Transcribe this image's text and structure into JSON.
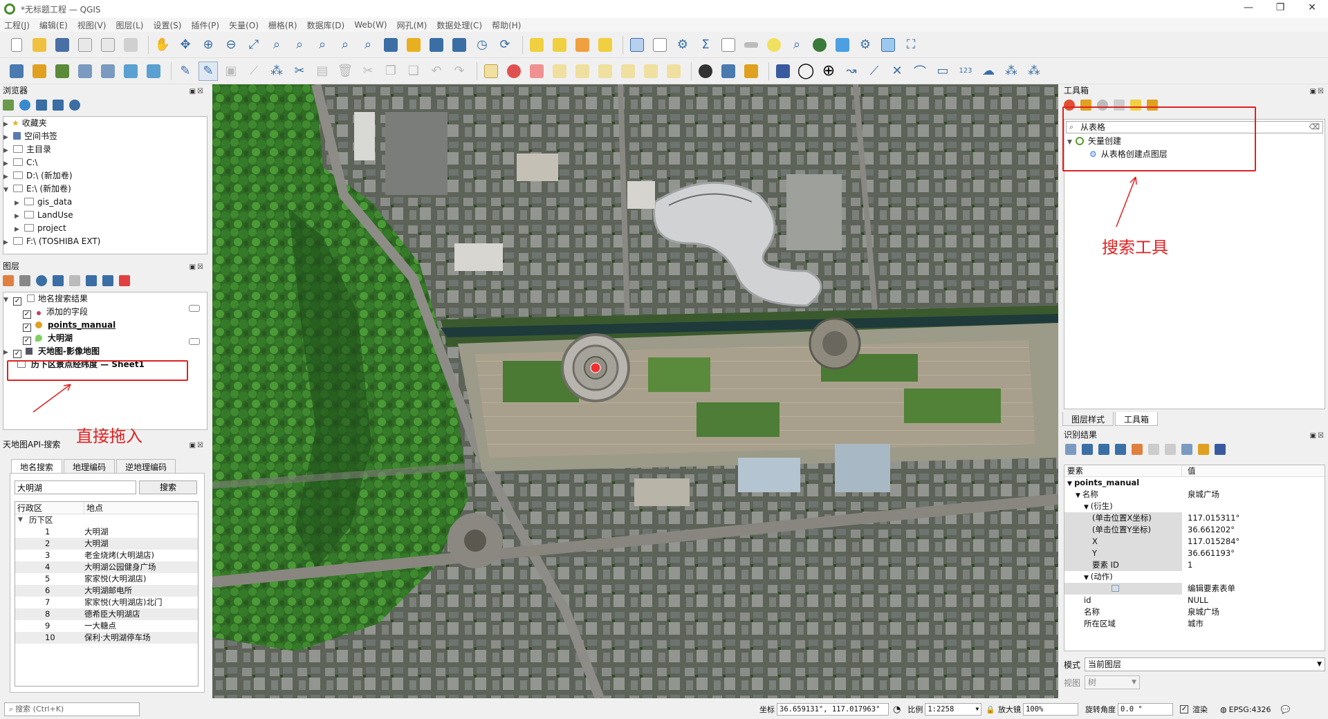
{
  "window": {
    "title": "*无标题工程 — QGIS"
  },
  "menu": [
    "工程(J)",
    "编辑(E)",
    "视图(V)",
    "图层(L)",
    "设置(S)",
    "插件(P)",
    "矢量(O)",
    "栅格(R)",
    "数据库(D)",
    "Web(W)",
    "网孔(M)",
    "数据处理(C)",
    "帮助(H)"
  ],
  "browser": {
    "title": "浏览器",
    "items": [
      {
        "label": "收藏夹",
        "indent": 0
      },
      {
        "label": "空间书签",
        "indent": 0
      },
      {
        "label": "主目录",
        "indent": 0
      },
      {
        "label": "C:\\",
        "indent": 0
      },
      {
        "label": "D:\\ (新加卷)",
        "indent": 0
      },
      {
        "label": "E:\\ (新加卷)",
        "indent": 0
      },
      {
        "label": "gis_data",
        "indent": 1
      },
      {
        "label": "LandUse",
        "indent": 1
      },
      {
        "label": "project",
        "indent": 1
      },
      {
        "label": "F:\\ (TOSHIBA EXT)",
        "indent": 0
      }
    ]
  },
  "layers": {
    "title": "图层",
    "items": [
      {
        "label": "地名搜索结果",
        "type": "group"
      },
      {
        "label": "添加的字段",
        "type": "layer"
      },
      {
        "label": "points_manual",
        "type": "layer"
      },
      {
        "label": "大明湖",
        "type": "layer"
      },
      {
        "label": "天地图-影像地图",
        "type": "raster"
      },
      {
        "label": "历下区景点经纬度 — Sheet1",
        "type": "table"
      }
    ]
  },
  "tianditu": {
    "title": "天地图API-搜索",
    "tabs": [
      "地名搜索",
      "地理编码",
      "逆地理编码"
    ],
    "search_value": "大明湖",
    "search_button": "搜索",
    "columns": [
      "行政区",
      "地点"
    ],
    "district": "历下区",
    "results": [
      {
        "n": "1",
        "place": "大明湖"
      },
      {
        "n": "2",
        "place": "大明湖"
      },
      {
        "n": "3",
        "place": "老金烧烤(大明湖店)"
      },
      {
        "n": "4",
        "place": "大明湖公园健身广场"
      },
      {
        "n": "5",
        "place": "家家悦(大明湖店)"
      },
      {
        "n": "6",
        "place": "大明湖邮电所"
      },
      {
        "n": "7",
        "place": "家家悦(大明湖店)北门"
      },
      {
        "n": "8",
        "place": "德希臣大明湖店"
      },
      {
        "n": "9",
        "place": "一大糖点"
      },
      {
        "n": "10",
        "place": "保利·大明湖停车场"
      }
    ]
  },
  "toolbox": {
    "title": "工具箱",
    "search_value": "从表格",
    "group": "矢量创建",
    "tool": "从表格创建点图层",
    "tabs": [
      "图层样式",
      "工具箱"
    ]
  },
  "identify": {
    "title": "识别结果",
    "columns": [
      "要素",
      "值"
    ],
    "rows": [
      {
        "k": "points_manual",
        "v": "",
        "indent": 0,
        "bold": true
      },
      {
        "k": "名称",
        "v": "泉城广场",
        "indent": 1
      },
      {
        "k": "(衍生)",
        "v": "",
        "indent": 2
      },
      {
        "k": "(单击位置X坐标)",
        "v": "117.015311°",
        "indent": 3,
        "hl": true
      },
      {
        "k": "(单击位置Y坐标)",
        "v": "36.661202°",
        "indent": 3,
        "hl": true
      },
      {
        "k": "X",
        "v": "117.015284°",
        "indent": 3,
        "hl": true
      },
      {
        "k": "Y",
        "v": "36.661193°",
        "indent": 3,
        "hl": true
      },
      {
        "k": "要素 ID",
        "v": "1",
        "indent": 3,
        "hl": true
      },
      {
        "k": "(动作)",
        "v": "",
        "indent": 2
      },
      {
        "k": "",
        "v": "编辑要素表单",
        "indent": 3,
        "hl": true
      },
      {
        "k": "id",
        "v": "NULL",
        "indent": 2
      },
      {
        "k": "名称",
        "v": "泉城广场",
        "indent": 2
      },
      {
        "k": "所在区域",
        "v": "城市",
        "indent": 2
      }
    ],
    "mode_label": "模式",
    "mode_value": "当前图层",
    "view_label": "视图",
    "view_value": "树"
  },
  "status": {
    "search_placeholder": "搜索 (Ctrl+K)",
    "coord_label": "坐标",
    "coord_value": "36.659131°, 117.017963°",
    "scale_label": "比例",
    "scale_value": "1:2258",
    "magnifier_label": "放大镜",
    "magnifier_value": "100%",
    "rotation_label": "旋转角度",
    "rotation_value": "0.0 °",
    "render_label": "渲染",
    "crs": "EPSG:4326"
  },
  "annotations": {
    "drag_in": "直接拖入",
    "search_tool": "搜索工具"
  }
}
